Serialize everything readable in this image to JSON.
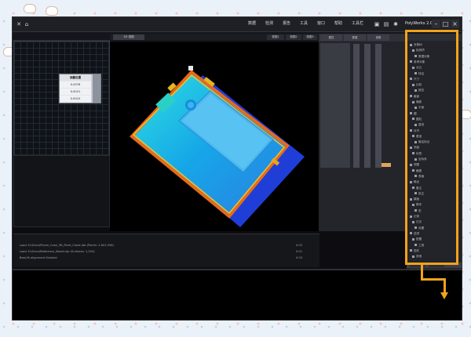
{
  "window": {
    "title": "PolyWorks 2.0",
    "menus": [
      "数据",
      "检测",
      "报告",
      "工具",
      "窗口",
      "帮助",
      "工具栏"
    ]
  },
  "viewport_tabs": [
    "3D 视图",
    "视图1",
    "视图2",
    "视图3"
  ],
  "float_box": {
    "title": "测量设置",
    "rows": [
      "0.0376",
      "0.0021",
      "0.0015",
      "0.01"
    ]
  },
  "props_tabs": [
    "属性",
    "数据",
    "参数"
  ],
  "tree_items": [
    "对象树",
    "检测项",
    "数据对象",
    "参考对象",
    "点云",
    "特征",
    "尺寸",
    "比较",
    "报告",
    "截面",
    "偏差",
    "平面",
    "圆",
    "圆柱",
    "直线",
    "对齐",
    "基准",
    "最佳拟合",
    "测量",
    "标签",
    "坐标系",
    "视图",
    "截图",
    "表格",
    "输出",
    "备注",
    "批注",
    "模板",
    "脚本",
    "宏",
    "记录",
    "日志",
    "设置",
    "选项",
    "配置",
    "工具",
    "插件",
    "其他"
  ],
  "console": {
    "header": "消息",
    "lines": [
      "Load: D:\\Scan\\Phone_Case_3D_Point_Cloud.dat  (Points: 2,841,556)",
      "Load: D:\\Scan\\Reference_Model.stp  (Surfaces: 1,204)",
      "Best-fit alignment finished"
    ],
    "right_values": [
      "0.02",
      "0.01",
      "0.03"
    ]
  },
  "colors": {
    "highlight": "#f2a31b",
    "window_bg": "#0d0d11",
    "panel_bg": "#23252b"
  },
  "icons": [
    "home-icon",
    "save-icon",
    "folder-icon",
    "settings-icon",
    "close-icon",
    "minimize-icon",
    "maximize-icon"
  ]
}
